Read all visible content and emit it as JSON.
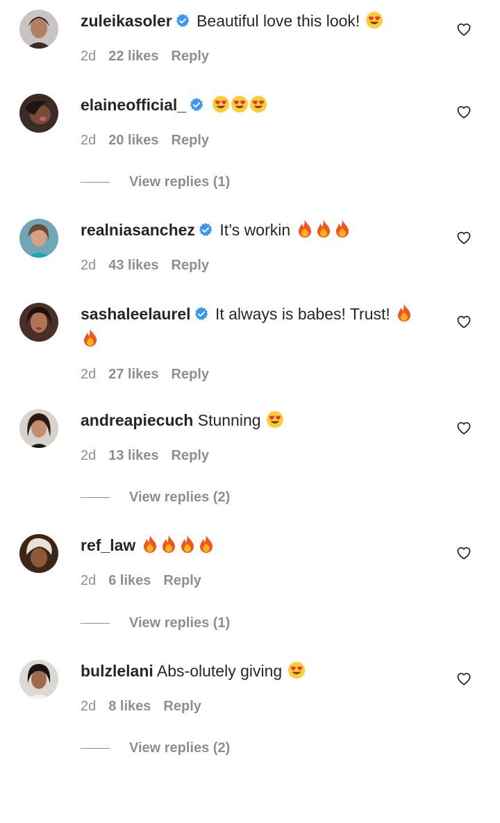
{
  "comments": [
    {
      "username": "zuleikasoler",
      "verified": true,
      "text": "Beautiful love this look!",
      "emojis": [
        "heart-eyes"
      ],
      "time": "2d",
      "likes": "22 likes",
      "reply": "Reply",
      "view_replies": ""
    },
    {
      "username": "elaineofficial_",
      "verified": true,
      "text": "",
      "emojis": [
        "heart-eyes",
        "heart-eyes",
        "heart-eyes"
      ],
      "time": "2d",
      "likes": "20 likes",
      "reply": "Reply",
      "view_replies": "View replies (1)"
    },
    {
      "username": "realniasanchez",
      "verified": true,
      "text": "It’s workin",
      "emojis": [
        "fire",
        "fire",
        "fire"
      ],
      "time": "2d",
      "likes": "43 likes",
      "reply": "Reply",
      "view_replies": ""
    },
    {
      "username": "sashaleelaurel",
      "verified": true,
      "text": "It always is babes! Trust!",
      "emojis": [
        "fire",
        "fire"
      ],
      "time": "2d",
      "likes": "27 likes",
      "reply": "Reply",
      "view_replies": ""
    },
    {
      "username": "andreapiecuch",
      "verified": false,
      "text": "Stunning",
      "emojis": [
        "heart-eyes"
      ],
      "time": "2d",
      "likes": "13 likes",
      "reply": "Reply",
      "view_replies": "View replies (2)"
    },
    {
      "username": "ref_law",
      "verified": false,
      "text": "",
      "emojis": [
        "fire",
        "fire",
        "fire",
        "fire"
      ],
      "time": "2d",
      "likes": "6 likes",
      "reply": "Reply",
      "view_replies": "View replies (1)"
    },
    {
      "username": "bulzlelani",
      "verified": false,
      "text": "Abs-olutely giving",
      "emojis": [
        "heart-eyes"
      ],
      "time": "2d",
      "likes": "8 likes",
      "reply": "Reply",
      "view_replies": "View replies (2)"
    }
  ],
  "colors": {
    "text": "#262626",
    "secondary": "#8e8e8e",
    "verified": "#3897f0"
  }
}
